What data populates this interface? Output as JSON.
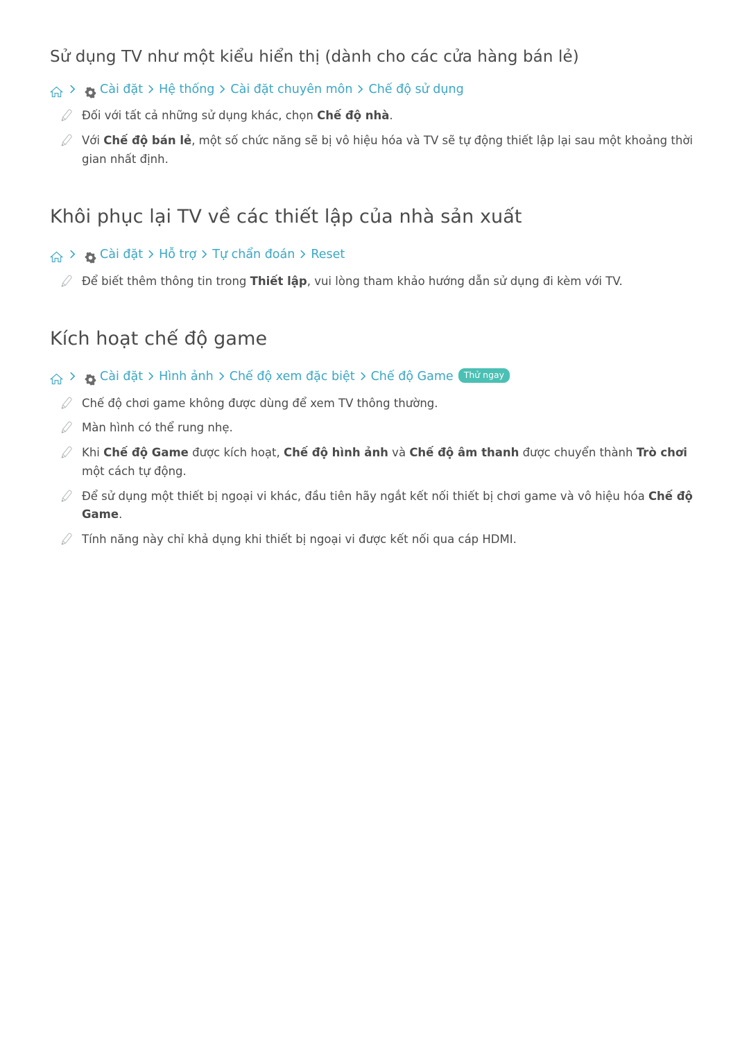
{
  "sections": [
    {
      "id": "retail",
      "heading": "Sử dụng TV như một kiểu hiển thị (dành cho các cửa hàng bán lẻ)",
      "heading_size": "small",
      "path": {
        "home_icon": "home-icon",
        "gear_icon": "gear-icon",
        "crumbs": [
          "Cài đặt",
          "Hệ thống",
          "Cài đặt chuyên môn",
          "Chế độ sử dụng"
        ],
        "badge": ""
      },
      "notes": [
        "Đối với tất cả những sử dụng khác, chọn <b>Chế độ nhà</b>.",
        "Với <b>Chế độ bán lẻ</b>, một số chức năng sẽ bị vô hiệu hóa và TV sẽ tự động thiết lập lại sau một khoảng thời gian nhất định."
      ]
    },
    {
      "id": "reset",
      "heading": "Khôi phục lại TV về các thiết lập của nhà sản xuất",
      "heading_size": "big",
      "path": {
        "home_icon": "home-icon",
        "gear_icon": "gear-icon",
        "crumbs": [
          "Cài đặt",
          "Hỗ trợ",
          "Tự chẩn đoán",
          "Reset"
        ],
        "badge": ""
      },
      "notes": [
        "Để biết thêm thông tin trong <b>Thiết lập</b>, vui lòng tham khảo hướng dẫn sử dụng đi kèm với TV."
      ]
    },
    {
      "id": "game-mode",
      "heading": "Kích hoạt chế độ game",
      "heading_size": "big",
      "path": {
        "home_icon": "home-icon",
        "gear_icon": "gear-icon",
        "crumbs": [
          "Cài đặt",
          "Hình ảnh",
          "Chế độ xem đặc biệt",
          "Chế độ Game"
        ],
        "badge": "Thử ngay"
      },
      "notes": [
        "Chế độ chơi game không được dùng để xem TV thông thường.",
        "Màn hình có thể rung nhẹ.",
        "Khi <b>Chế độ Game</b> được kích hoạt, <b>Chế độ hình ảnh</b> và <b>Chế độ âm thanh</b> được chuyển thành <b>Trò chơi</b> một cách tự động.",
        "Để sử dụng một thiết bị ngoại vi khác, đầu tiên hãy ngắt kết nối thiết bị chơi game và vô hiệu hóa <b>Chế độ Game</b>.",
        "Tính năng này chỉ khả dụng khi thiết bị ngoại vi được kết nối qua cáp HDMI."
      ]
    }
  ],
  "colors": {
    "link": "#3ba7c4",
    "badge_bg": "#4bc0b4",
    "text": "#4a4a4a"
  }
}
